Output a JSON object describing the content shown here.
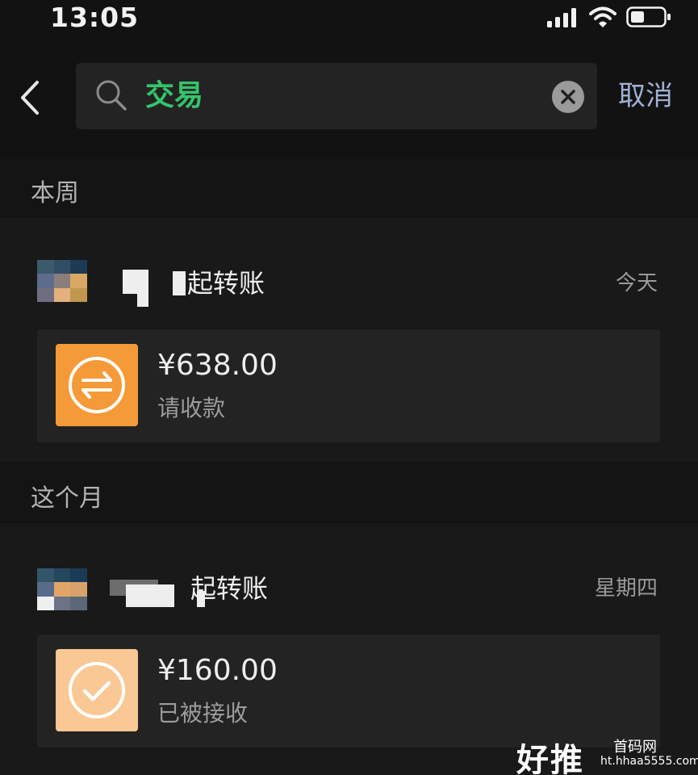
{
  "status_bar": {
    "time": "13:05",
    "signal_icon": "cellular-signal-icon",
    "wifi_icon": "wifi-icon",
    "battery_icon": "battery-icon"
  },
  "search": {
    "query": "交易",
    "cancel_label": "取消",
    "search_icon": "search-icon",
    "clear_icon": "clear-icon",
    "back_icon": "back-chevron-icon"
  },
  "sections": [
    {
      "label": "本周",
      "entry": {
        "title": "起转账",
        "date": "今天",
        "amount": "¥638.00",
        "status": "请收款",
        "icon": "transfer-arrows-icon",
        "icon_color": "#f59a38"
      }
    },
    {
      "label": "这个月",
      "entry": {
        "title": "起转账",
        "date": "星期四",
        "amount": "¥160.00",
        "status": "已被接收",
        "icon": "checkmark-icon",
        "icon_color": "#f9c894"
      }
    }
  ],
  "watermark": {
    "logo": "好推",
    "title": "首码网",
    "url": "ht.hhaa5555.com"
  },
  "colors": {
    "accent_green": "#35c46b",
    "cancel_blue": "#9fb1d4",
    "background": "#121212"
  }
}
